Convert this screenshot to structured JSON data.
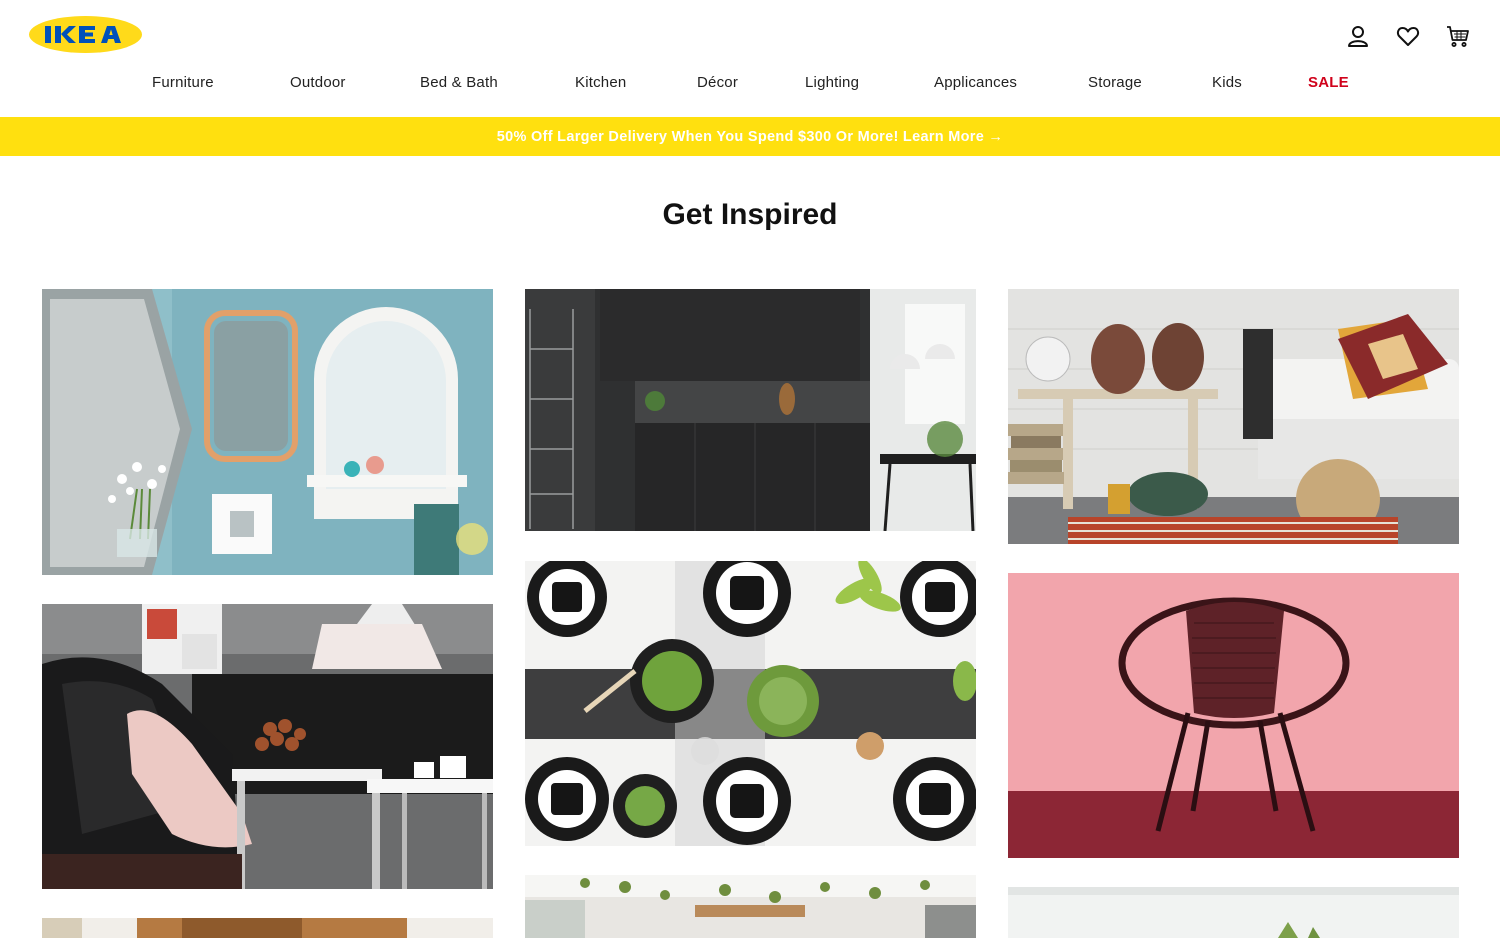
{
  "brand": {
    "name": "IKEA",
    "logo_blue": "#0051ba",
    "logo_yellow": "#ffda1a"
  },
  "header": {
    "icons": [
      "account-icon",
      "heart-icon",
      "cart-icon"
    ]
  },
  "nav": {
    "items": [
      {
        "label": "Furniture"
      },
      {
        "label": "Outdoor"
      },
      {
        "label": "Bed & Bath"
      },
      {
        "label": "Kitchen"
      },
      {
        "label": "Décor"
      },
      {
        "label": "Lighting"
      },
      {
        "label": "Applicances"
      },
      {
        "label": "Storage"
      },
      {
        "label": "Kids"
      },
      {
        "label": "SALE",
        "color": "#d0021b"
      }
    ]
  },
  "banner": {
    "text": "50% Off Larger Delivery When You Spend $300 Or More! Learn More →",
    "background": "#ffe00f"
  },
  "main": {
    "title": "Get Inspired",
    "tiles": [
      {
        "subject": "mirrors-on-blue-wall"
      },
      {
        "subject": "black-kitchen"
      },
      {
        "subject": "living-room-white-sofa-pots"
      },
      {
        "subject": "black-armchair-fireplace"
      },
      {
        "subject": "table-setting-black-plates"
      },
      {
        "subject": "rattan-chair-pink-background"
      },
      {
        "subject": "patio-with-plants"
      },
      {
        "subject": "bright-room"
      },
      {
        "subject": "wooden-furniture"
      }
    ]
  }
}
